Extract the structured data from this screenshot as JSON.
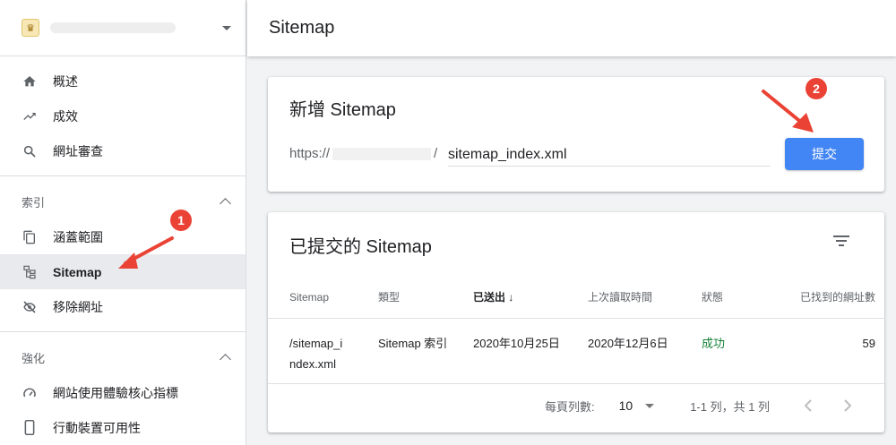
{
  "sidebar": {
    "property_logo": "♛",
    "items_top": [
      {
        "label": "概述",
        "icon": "home-icon"
      },
      {
        "label": "成效",
        "icon": "trending-up-icon"
      },
      {
        "label": "網址審查",
        "icon": "search-icon"
      }
    ],
    "section_index": {
      "title": "索引",
      "items": [
        {
          "label": "涵蓋範圍",
          "icon": "copy-icon"
        },
        {
          "label": "Sitemap",
          "icon": "sitemap-icon"
        },
        {
          "label": "移除網址",
          "icon": "visibility-off-icon"
        }
      ]
    },
    "section_enhance": {
      "title": "強化",
      "items": [
        {
          "label": "網站使用體驗核心指標",
          "icon": "speed-icon"
        },
        {
          "label": "行動裝置可用性",
          "icon": "phone-icon"
        }
      ]
    }
  },
  "header": {
    "title": "Sitemap"
  },
  "add_card": {
    "title": "新增 Sitemap",
    "url_prefix_start": "https://",
    "url_prefix_end": "/",
    "input_value": "sitemap_index.xml",
    "submit_label": "提交"
  },
  "submitted_card": {
    "title": "已提交的 Sitemap",
    "columns": [
      "Sitemap",
      "類型",
      "已送出",
      "上次讀取時間",
      "狀態",
      "已找到的網址數"
    ],
    "sort_arrow": "↓",
    "rows": [
      {
        "sitemap": "/sitemap_index.xml",
        "type": "Sitemap 索引",
        "submitted": "2020年10月25日",
        "last_read": "2020年12月6日",
        "status": "成功",
        "urls": "59"
      }
    ],
    "pager": {
      "rows_per_page_label": "每頁列數:",
      "rows_per_page": "10",
      "range": "1-1 列，共 1 列"
    }
  },
  "annotations": {
    "badge1": "1",
    "badge2": "2"
  },
  "colors": {
    "accent": "#4285f4",
    "success": "#188038",
    "annotation": "#ea4335"
  }
}
